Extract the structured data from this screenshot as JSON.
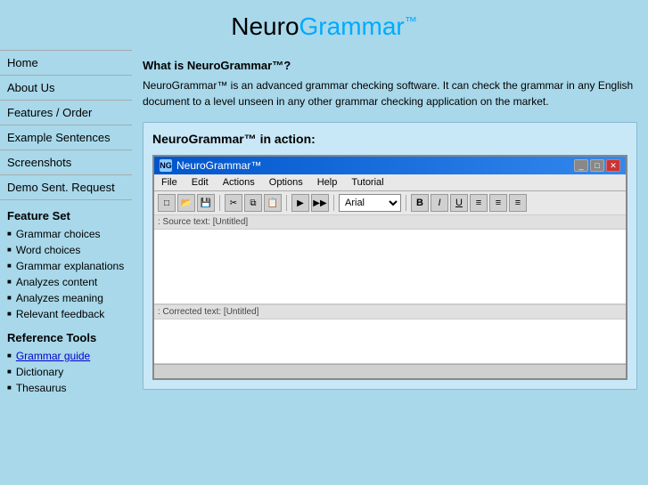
{
  "header": {
    "title_neuro": "Neuro",
    "title_grammar": "Grammar",
    "tm": "™"
  },
  "sidebar": {
    "nav_items": [
      {
        "label": "Home",
        "id": "home"
      },
      {
        "label": "About Us",
        "id": "about-us"
      },
      {
        "label": "Features / Order",
        "id": "features-order"
      },
      {
        "label": "Example Sentences",
        "id": "example-sentences"
      },
      {
        "label": "Screenshots",
        "id": "screenshots"
      },
      {
        "label": "Demo Sent. Request",
        "id": "demo-sent-request"
      }
    ],
    "feature_set_title": "Feature Set",
    "features": [
      "Grammar choices",
      "Word choices",
      "Grammar explanations",
      "Analyzes content",
      "Analyzes meaning",
      "Relevant feedback"
    ],
    "reference_tools_title": "Reference Tools",
    "reference_items": [
      {
        "label": "Grammar guide",
        "link": true
      },
      {
        "label": "Dictionary",
        "link": false
      },
      {
        "label": "Thesaurus",
        "link": false
      }
    ]
  },
  "main": {
    "what_is_title": "What is NeuroGrammar™?",
    "what_is_text": "NeuroGrammar™ is an advanced grammar checking software. It can check the grammar in any English document to a level unseen in any other grammar checking application on the market.",
    "demo_title": "NeuroGrammar™ in action:",
    "app_window": {
      "title": "NeuroGrammar™",
      "menu_items": [
        "File",
        "Edit",
        "Actions",
        "Options",
        "Help",
        "Tutorial"
      ],
      "toolbar": {
        "font": "Arial",
        "format_btns": [
          "B",
          "I",
          "U",
          "≡",
          "≡",
          "≡"
        ]
      },
      "source_label": ": Source text: [Untitled]",
      "corrected_label": ": Corrected text: [Untitled]",
      "titlebar_buttons": [
        "_",
        "□",
        "✕"
      ]
    }
  }
}
